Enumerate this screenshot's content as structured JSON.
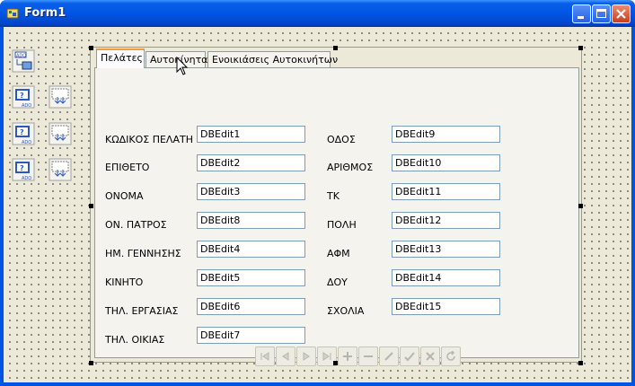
{
  "window": {
    "title": "Form1"
  },
  "tabs": [
    {
      "label": "Πελάτες",
      "active": true
    },
    {
      "label": "Αυτοκίνητα",
      "active": false
    },
    {
      "label": "Ενοικιάσεις Αυτοκινήτων",
      "active": false
    }
  ],
  "left_fields": [
    {
      "label": "ΚΩΔΙΚΟΣ ΠΕΛΑΤΗ",
      "value": "DBEdit1"
    },
    {
      "label": "ΕΠΙΘΕΤΟ",
      "value": "DBEdit2"
    },
    {
      "label": "ΟΝΟΜΑ",
      "value": "DBEdit3"
    },
    {
      "label": "ΟΝ. ΠΑΤΡΟΣ",
      "value": "DBEdit8"
    },
    {
      "label": "ΗΜ. ΓΕΝΝΗΣΗΣ",
      "value": "DBEdit4"
    },
    {
      "label": "ΚΙΝΗΤΟ",
      "value": "DBEdit5"
    },
    {
      "label": "ΤΗΛ. ΕΡΓΑΣΙΑΣ",
      "value": "DBEdit6"
    },
    {
      "label": "ΤΗΛ. ΟΙΚΙΑΣ",
      "value": "DBEdit7"
    }
  ],
  "right_fields": [
    {
      "label": "ΟΔΟΣ",
      "value": "DBEdit9"
    },
    {
      "label": "ΑΡΙΘΜΟΣ",
      "value": "DBEdit10"
    },
    {
      "label": "ΤΚ",
      "value": "DBEdit11"
    },
    {
      "label": "ΠΟΛΗ",
      "value": "DBEdit12"
    },
    {
      "label": "ΑΦΜ",
      "value": "DBEdit13"
    },
    {
      "label": "ΔΟΥ",
      "value": "DBEdit14"
    },
    {
      "label": "ΣΧΟΛΙΑ",
      "value": "DBEdit15"
    }
  ],
  "nav_buttons": [
    "first-icon",
    "prior-icon",
    "next-icon",
    "last-icon",
    "insert-icon",
    "delete-icon",
    "edit-icon",
    "post-icon",
    "cancel-icon",
    "refresh-icon"
  ],
  "nonvisual_components": [
    "ado-connection-icon",
    "ado-table-icon",
    "datasource-icon"
  ],
  "colors": {
    "titlebar": "#0055e5",
    "form_bg": "#ece9d8",
    "tab_highlight": "#f0a030",
    "close_button": "#c4401d"
  }
}
